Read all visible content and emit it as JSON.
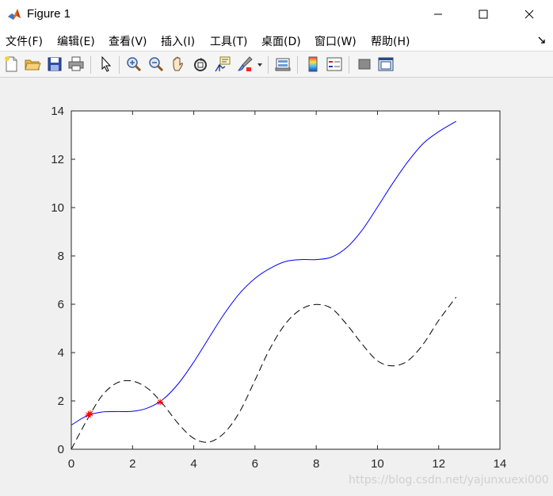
{
  "window": {
    "title": "Figure 1",
    "icon": "matlab-icon"
  },
  "menu": [
    {
      "label": "文件(F)"
    },
    {
      "label": "编辑(E)"
    },
    {
      "label": "查看(V)"
    },
    {
      "label": "插入(I)"
    },
    {
      "label": "工具(T)"
    },
    {
      "label": "桌面(D)"
    },
    {
      "label": "窗口(W)"
    },
    {
      "label": "帮助(H)"
    }
  ],
  "toolbar": [
    "new-figure-icon",
    "open-file-icon",
    "save-icon",
    "print-icon",
    "edit-plot-arrow-icon",
    "zoom-in-icon",
    "zoom-out-icon",
    "pan-hand-icon",
    "rotate-3d-icon",
    "data-cursor-icon",
    "brush-icon",
    "link-plot-icon",
    "colorbar-icon",
    "legend-icon",
    "hide-plot-tools-icon",
    "show-plot-tools-icon"
  ],
  "watermark": "https://blog.csdn.net/yajunxuexi000",
  "chart_data": {
    "type": "line",
    "xlim": [
      0,
      14
    ],
    "ylim": [
      0,
      14
    ],
    "xticks": [
      0,
      2,
      4,
      6,
      8,
      10,
      12,
      14
    ],
    "yticks": [
      0,
      2,
      4,
      6,
      8,
      10,
      12,
      14
    ],
    "grid": false,
    "series": [
      {
        "style": "solid",
        "color": "#0000ff",
        "x": [
          0,
          0.5,
          1,
          1.5,
          2,
          2.5,
          3,
          3.5,
          4,
          4.5,
          5,
          5.5,
          6,
          6.5,
          7,
          7.5,
          8,
          8.5,
          9,
          9.5,
          10,
          10.5,
          11,
          11.5,
          12,
          12.57
        ],
        "y": [
          1.0,
          1.38,
          1.54,
          1.56,
          1.57,
          1.71,
          2.07,
          2.72,
          3.61,
          4.62,
          5.61,
          6.45,
          7.07,
          7.49,
          7.77,
          7.85,
          7.85,
          7.95,
          8.35,
          9.07,
          10.02,
          11.01,
          11.91,
          12.66,
          13.14,
          13.57
        ]
      },
      {
        "style": "dashed",
        "color": "#000000",
        "x": [
          0,
          0.5,
          1,
          1.5,
          2,
          2.5,
          3,
          3.5,
          4,
          4.5,
          5,
          5.5,
          6,
          6.5,
          7,
          7.5,
          8,
          8.5,
          9,
          9.5,
          10,
          10.5,
          11,
          11.5,
          12,
          12.57
        ],
        "y": [
          0,
          1.18,
          2.21,
          2.75,
          2.82,
          2.51,
          1.86,
          1.05,
          0.45,
          0.3,
          0.68,
          1.55,
          2.86,
          4.19,
          5.2,
          5.79,
          5.99,
          5.83,
          5.16,
          4.35,
          3.66,
          3.45,
          3.67,
          4.36,
          5.33,
          6.3
        ]
      }
    ],
    "markers": [
      {
        "x": 0.56,
        "y": 1.42,
        "color": "#ff0000"
      },
      {
        "x": 0.62,
        "y": 1.48,
        "color": "#ff0000"
      },
      {
        "x": 2.9,
        "y": 1.95,
        "color": "#ff0000"
      }
    ]
  }
}
